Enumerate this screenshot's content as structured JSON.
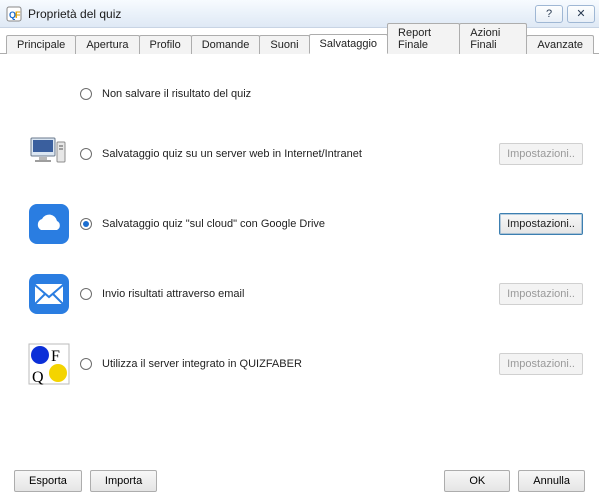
{
  "window": {
    "title": "Proprietà del quiz",
    "help_glyph": "?",
    "close_glyph": "✕"
  },
  "tabs": {
    "items": [
      {
        "label": "Principale"
      },
      {
        "label": "Apertura"
      },
      {
        "label": "Profilo"
      },
      {
        "label": "Domande"
      },
      {
        "label": "Suoni"
      },
      {
        "label": "Salvataggio"
      },
      {
        "label": "Report Finale"
      },
      {
        "label": "Azioni Finali"
      },
      {
        "label": "Avanzate"
      }
    ],
    "active_index": 5
  },
  "options": {
    "no_save": {
      "label": "Non salvare il risultato del quiz"
    },
    "server": {
      "label": "Salvataggio quiz su un server web in Internet/Intranet",
      "button": "Impostazioni.."
    },
    "cloud": {
      "label": "Salvataggio quiz \"sul cloud\" con Google Drive",
      "button": "Impostazioni.."
    },
    "email": {
      "label": "Invio risultati attraverso email",
      "button": "Impostazioni.."
    },
    "integrated": {
      "label": "Utilizza il server integrato in QUIZFABER",
      "button": "Impostazioni.."
    },
    "selected": "cloud"
  },
  "buttons": {
    "export": "Esporta",
    "import": "Importa",
    "ok": "OK",
    "cancel": "Annulla"
  },
  "icons": {
    "app": "app-icon",
    "server": "desktop-computer-icon",
    "cloud": "cloud-icon",
    "email": "envelope-icon",
    "integrated": "quizfaber-icon"
  }
}
